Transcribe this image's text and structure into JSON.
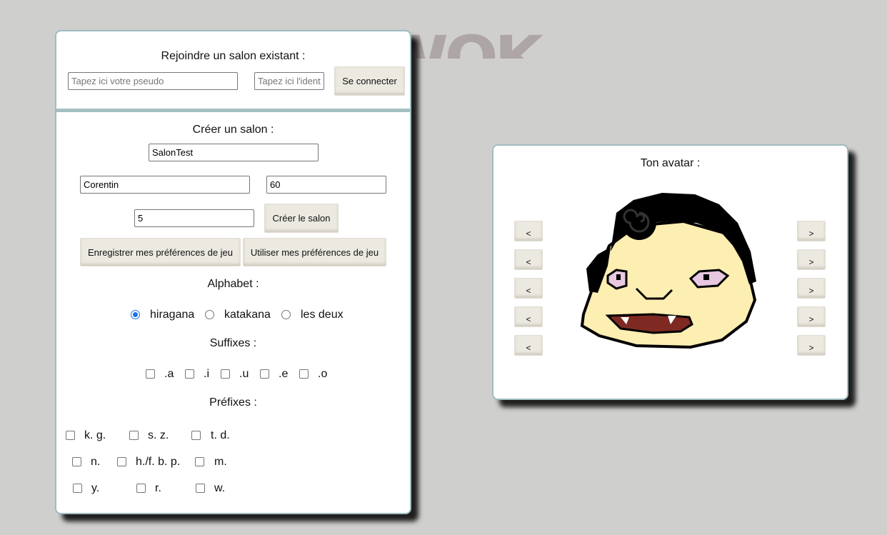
{
  "logo_text": "NEWOK",
  "join": {
    "title": "Rejoindre un salon existant :",
    "pseudo_placeholder": "Tapez ici votre pseudo",
    "id_placeholder": "Tapez ici l'identifiant",
    "connect_label": "Se connecter"
  },
  "create": {
    "title": "Créer un salon :",
    "room_name": "SalonTest",
    "player_name": "Corentin",
    "time_value": "60",
    "rounds_value": "5",
    "create_label": "Créer le salon",
    "save_prefs_label": "Enregistrer mes préférences de jeu",
    "use_prefs_label": "Utiliser mes préférences de jeu"
  },
  "alphabet": {
    "title": "Alphabet :",
    "options": [
      "hiragana",
      "katakana",
      "les deux"
    ],
    "selected": "hiragana"
  },
  "suffixes": {
    "title": "Suffixes :",
    "options": [
      ".a",
      ".i",
      ".u",
      ".e",
      ".o"
    ]
  },
  "prefixes": {
    "title": "Préfixes :",
    "options": [
      "k. g.",
      "s. z.",
      "t. d.",
      "n.",
      "h./f. b. p.",
      "m.",
      "y.",
      "r.",
      "w."
    ]
  },
  "avatar": {
    "title": "Ton avatar :",
    "prev_label": "<",
    "next_label": ">",
    "colors": {
      "skin": "#fdeeb2",
      "hair": "#000000",
      "mouth": "#7e2a22",
      "eye": "#e8c7e0"
    }
  },
  "colors": {
    "background": "#cfcfcd",
    "panel_border": "#9fbcc0",
    "button": "#ece9e1",
    "radio": "#1a73e8"
  }
}
